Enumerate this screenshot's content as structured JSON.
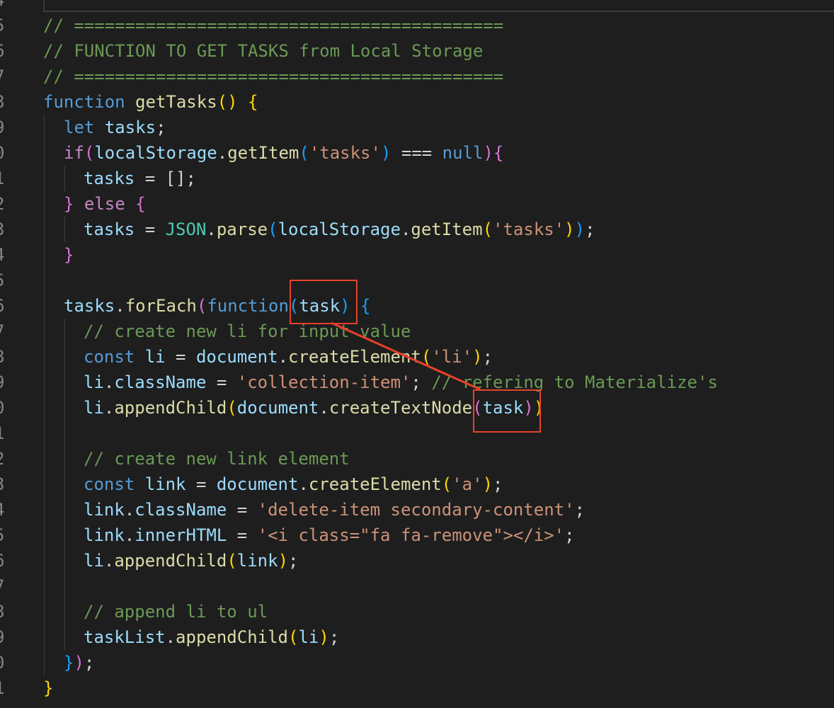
{
  "gutter": {
    "line_numbers": [
      "4",
      "5",
      "6",
      "7",
      "8",
      "9",
      "0",
      "1",
      "2",
      "3",
      "4",
      "5",
      "6",
      "7",
      "8",
      "9",
      "0",
      "1",
      "2",
      "3",
      "4",
      "5",
      "6",
      "7",
      "8",
      "9",
      "0",
      "1"
    ]
  },
  "code": {
    "l1": "// ==========================================",
    "l2": "// FUNCTION TO GET TASKS from Local Storage",
    "l3": "// ==========================================",
    "l4_kw": "function",
    "l4_fn": "getTasks",
    "l4_paren": "()",
    "l4_brace": "{",
    "l5_kw": "let",
    "l5_var": "tasks",
    "l5_end": ";",
    "l6_if": "if",
    "l6_open": "(",
    "l6_obj": "localStorage",
    "l6_dot": ".",
    "l6_fn": "getItem",
    "l6_p1": "(",
    "l6_str": "'tasks'",
    "l6_p2": ")",
    "l6_op": " === ",
    "l6_null": "null",
    "l6_close": ")",
    "l6_brace": "{",
    "l7_var": "tasks",
    "l7_rest": " = [];",
    "l8_brace": "}",
    "l8_else": " else ",
    "l8_open": "{",
    "l9_var": "tasks",
    "l9_eq": " = ",
    "l9_json": "JSON",
    "l9_dot": ".",
    "l9_parse": "parse",
    "l9_p1": "(",
    "l9_obj": "localStorage",
    "l9_dot2": ".",
    "l9_fn": "getItem",
    "l9_p2": "(",
    "l9_str": "'tasks'",
    "l9_p3": ")",
    "l9_p4": ")",
    "l9_end": ";",
    "l10_brace": "}",
    "l12_var": "tasks",
    "l12_dot": ".",
    "l12_fn": "forEach",
    "l12_p1": "(",
    "l12_kw": "function",
    "l12_p2": "(",
    "l12_param": "task",
    "l12_p3": ")",
    "l12_brace": " {",
    "l13": "// create new li for input value",
    "l14_kw": "const",
    "l14_var": "li",
    "l14_eq": " = ",
    "l14_obj": "document",
    "l14_dot": ".",
    "l14_fn": "createElement",
    "l14_p1": "(",
    "l14_str": "'li'",
    "l14_p2": ")",
    "l14_end": ";",
    "l15_var": "li",
    "l15_dot": ".",
    "l15_prop": "className",
    "l15_eq": " = ",
    "l15_str": "'collection-item'",
    "l15_end": "; ",
    "l15_comment": "// refering to Materialize's",
    "l16_var": "li",
    "l16_dot": ".",
    "l16_fn": "appendChild",
    "l16_p1": "(",
    "l16_obj": "document",
    "l16_dot2": ".",
    "l16_fn2": "createTextNode",
    "l16_p2": "(",
    "l16_arg": "task",
    "l16_p3": ")",
    "l16_p4": ")",
    "l18": "// create new link element",
    "l19_kw": "const",
    "l19_var": "link",
    "l19_eq": " = ",
    "l19_obj": "document",
    "l19_dot": ".",
    "l19_fn": "createElement",
    "l19_p1": "(",
    "l19_str": "'a'",
    "l19_p2": ")",
    "l19_end": ";",
    "l20_var": "link",
    "l20_dot": ".",
    "l20_prop": "className",
    "l20_eq": " = ",
    "l20_str": "'delete-item secondary-content'",
    "l20_end": ";",
    "l21_var": "link",
    "l21_dot": ".",
    "l21_prop": "innerHTML",
    "l21_eq": " = ",
    "l21_str": "'<i class=\"fa fa-remove\"></i>'",
    "l21_end": ";",
    "l22_var": "li",
    "l22_dot": ".",
    "l22_fn": "appendChild",
    "l22_p1": "(",
    "l22_arg": "link",
    "l22_p2": ")",
    "l22_end": ";",
    "l24": "// append li to ul",
    "l25_var": "taskList",
    "l25_dot": ".",
    "l25_fn": "appendChild",
    "l25_p1": "(",
    "l25_arg": "li",
    "l25_p2": ")",
    "l25_end": ";",
    "l26_brace": "}",
    "l26_paren": ")",
    "l26_end": ";",
    "l27_brace": "}"
  },
  "colors": {
    "background": "#1e1e1e",
    "annotation": "#e8412a",
    "comment": "#6a9955",
    "keyword": "#569cd6",
    "string": "#ce9178"
  }
}
